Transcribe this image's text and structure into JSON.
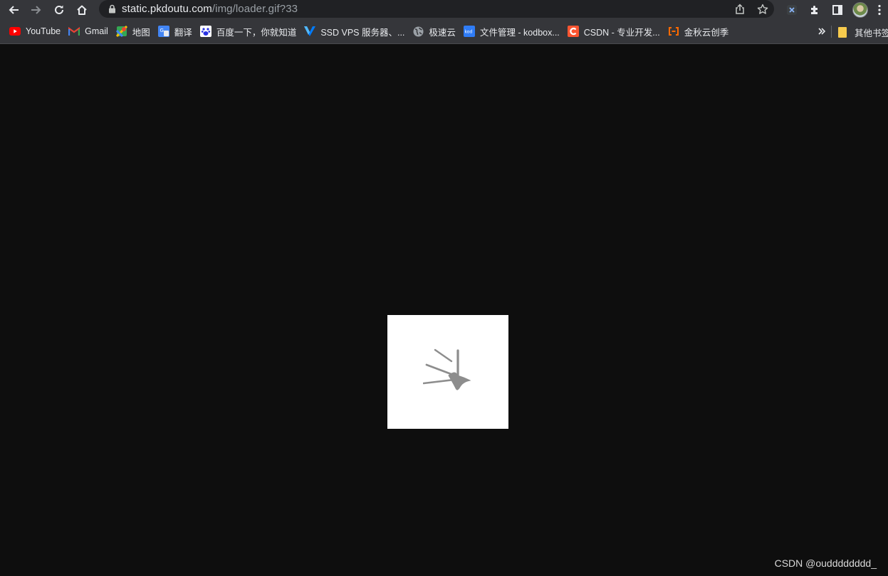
{
  "window": {
    "title": "loader.gif"
  },
  "toolbar": {
    "back": "back-arrow",
    "forward": "forward-arrow",
    "reload": "reload",
    "home": "home"
  },
  "address_bar": {
    "host": "static.pkdoutu.com",
    "path": "/img/loader.gif?33"
  },
  "bookmarks": [
    {
      "label": "YouTube",
      "icon": "youtube-icon",
      "color": "#ff0000"
    },
    {
      "label": "Gmail",
      "icon": "gmail-icon",
      "color": "#ea4335"
    },
    {
      "label": "地图",
      "icon": "maps-icon",
      "color": "#34a853"
    },
    {
      "label": "翻译",
      "icon": "translate-icon",
      "color": "#4285f4"
    },
    {
      "label": "百度一下，你就知道",
      "icon": "baidu-icon",
      "color": "#2932e1"
    },
    {
      "label": "SSD VPS 服务器、...",
      "icon": "vultr-icon",
      "color": "#007bfc"
    },
    {
      "label": "极速云",
      "icon": "globe-icon",
      "color": "#9aa0a6"
    },
    {
      "label": "文件管理 - kodbox...",
      "icon": "kodbox-icon",
      "color": "#2f7cf6"
    },
    {
      "label": "CSDN - 专业开发...",
      "icon": "csdn-icon",
      "color": "#fc5531"
    },
    {
      "label": "金秋云创季",
      "icon": "aliyun-icon",
      "color": "#ff6a00"
    }
  ],
  "other_bookmarks": {
    "label": "其他书签",
    "icon": "folder-icon",
    "color": "#f7cb4d"
  },
  "content": {
    "image_alt": "loader.gif",
    "watermark": "CSDN @oudddddddd_"
  }
}
